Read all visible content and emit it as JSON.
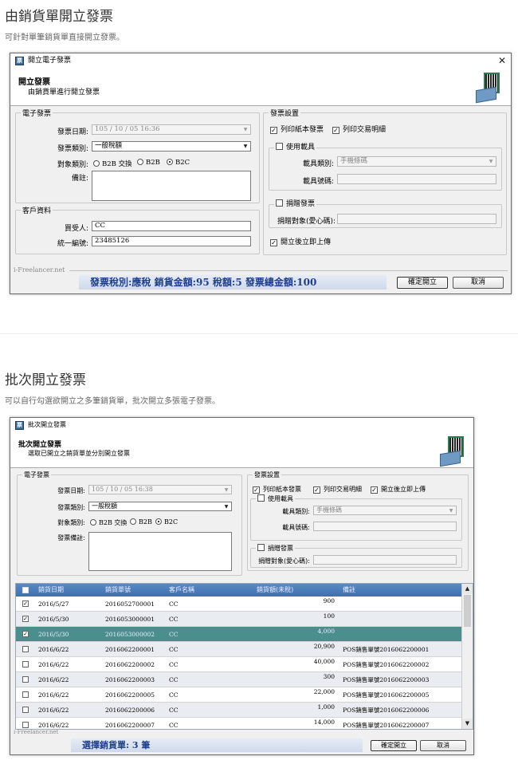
{
  "section1": {
    "title": "由銷貨單開立發票",
    "desc": "可針對單筆銷貨單直接開立發票。",
    "window": {
      "title": "開立電子發票",
      "header_title": "開立發票",
      "header_sub": "由銷貨單進行開立發票",
      "invoice_group": "電子發票",
      "date_label": "發票日期:",
      "date_value": "105 / 10 / 05  16:36",
      "category_label": "發票類別:",
      "category_value": "一般稅額",
      "target_label": "對象類別:",
      "target_options": [
        "B2B 交換",
        "B2B",
        "B2C"
      ],
      "note_label": "備註:",
      "customer_group": "客戶資料",
      "buyer_label": "買受人:",
      "buyer_value": "CC",
      "taxid_label": "統一編號:",
      "taxid_value": "23485126",
      "settings_group": "發票設置",
      "print_paper": "列印紙本發票",
      "print_detail": "列印交易明細",
      "carrier_group": "使用載具",
      "carrier_type_label": "載具類別:",
      "carrier_type_value": "手機條碼",
      "carrier_no_label": "載具號碼:",
      "donate_group": "捐贈發票",
      "donate_target_label": "捐贈對象(愛心碼):",
      "upload_label": "開立後立即上傳",
      "watermark": "i-Freelancer.net",
      "status": "發票稅別:應稅  銷貨金額:95    稅額:5    發票總金額:100",
      "ok_label": "確定開立",
      "cancel_label": "取消"
    }
  },
  "section2": {
    "title": "批次開立發票",
    "desc": "可以自行勾選欲開立之多筆銷貨單，批次開立多張電子發票。",
    "window": {
      "title": "批次開立發票",
      "header_title": "批次開立發票",
      "header_sub": "選取已開立之銷貨單並分別開立發票",
      "invoice_group": "電子發票",
      "date_label": "發票日期:",
      "date_value": "105 / 10 / 05  16:38",
      "category_label": "發票類別:",
      "category_value": "一般稅額",
      "target_label": "對象類別:",
      "target_options": [
        "B2B 交換",
        "B2B",
        "B2C"
      ],
      "note_label": "發票備註:",
      "settings_group": "發票設置",
      "print_paper": "列印紙本發票",
      "print_detail": "列印交易明細",
      "upload_label": "開立後立即上傳",
      "carrier_group": "使用載具",
      "carrier_type_label": "載具類別:",
      "carrier_type_value": "手機條碼",
      "carrier_no_label": "載具號碼:",
      "donate_group": "捐贈發票",
      "donate_target_label": "捐贈對象(愛心碼):",
      "columns": [
        "銷貨日期",
        "銷貨單號",
        "客戶名稱",
        "銷貨額(未稅)",
        "備註"
      ],
      "rows": [
        {
          "checked": true,
          "date": "2016/5/27",
          "no": "2016052700001",
          "customer": "CC",
          "amount": "900",
          "note": ""
        },
        {
          "checked": true,
          "date": "2016/5/30",
          "no": "2016053000001",
          "customer": "CC",
          "amount": "100",
          "note": ""
        },
        {
          "checked": true,
          "date": "2016/5/30",
          "no": "2016053000002",
          "customer": "CC",
          "amount": "4,000",
          "note": ""
        },
        {
          "checked": false,
          "date": "2016/6/22",
          "no": "2016062200001",
          "customer": "CC",
          "amount": "20,900",
          "note": "POS銷售單號2016062200001"
        },
        {
          "checked": false,
          "date": "2016/6/22",
          "no": "2016062200002",
          "customer": "CC",
          "amount": "40,000",
          "note": "POS銷售單號2016062200002"
        },
        {
          "checked": false,
          "date": "2016/6/22",
          "no": "2016062200003",
          "customer": "CC",
          "amount": "300",
          "note": "POS銷售單號2016062200003"
        },
        {
          "checked": false,
          "date": "2016/6/22",
          "no": "2016062200005",
          "customer": "CC",
          "amount": "22,000",
          "note": "POS銷售單號2016062200005"
        },
        {
          "checked": false,
          "date": "2016/6/22",
          "no": "2016062200006",
          "customer": "CC",
          "amount": "1,000",
          "note": "POS銷售單號2016062200006"
        },
        {
          "checked": false,
          "date": "2016/6/22",
          "no": "2016062200007",
          "customer": "CC",
          "amount": "14,000",
          "note": "POS銷售單號2016062200007"
        }
      ],
      "watermark": "i-Freelancer.net",
      "status": "選擇銷貨單: 3 筆",
      "ok_label": "確定開立",
      "cancel_label": "取消"
    }
  }
}
